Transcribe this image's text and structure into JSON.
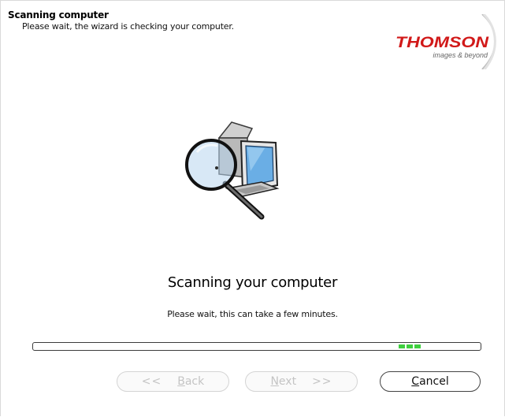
{
  "header": {
    "title": "Scanning computer",
    "subtitle": "Please wait, the wizard is checking your computer."
  },
  "logo": {
    "brand": "THOMSON",
    "tagline": "images & beyond",
    "brand_color": "#d11919"
  },
  "main": {
    "heading": "Scanning your computer",
    "subtext": "Please wait, this can take a few minutes.",
    "illustration_icon": "magnifier-over-computer-icon"
  },
  "progress": {
    "mode": "marquee",
    "chunk_count": 3,
    "color": "#3fcf3f"
  },
  "buttons": {
    "back": {
      "prefix": "<<",
      "label": "Back",
      "access_key": "B",
      "rest": "ack",
      "enabled": false
    },
    "next": {
      "label": "Next",
      "access_key": "N",
      "rest": "ext",
      "suffix": ">>",
      "enabled": false
    },
    "cancel": {
      "label": "Cancel",
      "access_key": "C",
      "rest": "ancel",
      "enabled": true
    }
  }
}
